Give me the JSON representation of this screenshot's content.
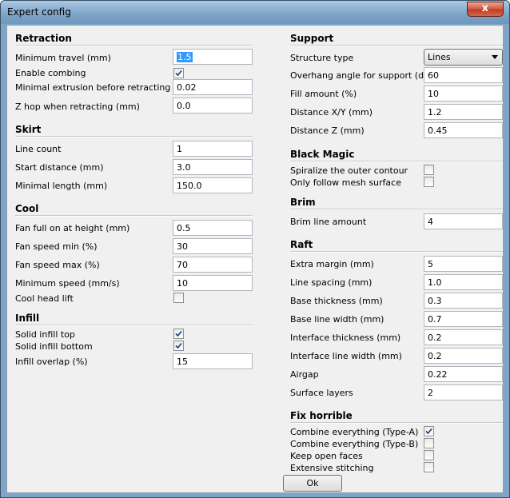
{
  "window": {
    "title": "Expert config",
    "close_glyph": "x"
  },
  "left": {
    "retraction": {
      "header": "Retraction",
      "min_travel": {
        "label": "Minimum travel (mm)",
        "value": "1.5"
      },
      "enable_combing": {
        "label": "Enable combing",
        "checked": true
      },
      "min_extrusion": {
        "label": "Minimal extrusion before retracting (mm)",
        "value": "0.02"
      },
      "z_hop": {
        "label": "Z hop when retracting (mm)",
        "value": "0.0"
      }
    },
    "skirt": {
      "header": "Skirt",
      "line_count": {
        "label": "Line count",
        "value": "1"
      },
      "start_distance": {
        "label": "Start distance (mm)",
        "value": "3.0"
      },
      "min_length": {
        "label": "Minimal length (mm)",
        "value": "150.0"
      }
    },
    "cool": {
      "header": "Cool",
      "fan_full_height": {
        "label": "Fan full on at height (mm)",
        "value": "0.5"
      },
      "fan_speed_min": {
        "label": "Fan speed min (%)",
        "value": "30"
      },
      "fan_speed_max": {
        "label": "Fan speed max (%)",
        "value": "70"
      },
      "min_speed": {
        "label": "Minimum speed (mm/s)",
        "value": "10"
      },
      "cool_head_lift": {
        "label": "Cool head lift",
        "checked": false
      }
    },
    "infill": {
      "header": "Infill",
      "solid_top": {
        "label": "Solid infill top",
        "checked": true
      },
      "solid_bottom": {
        "label": "Solid infill bottom",
        "checked": true
      },
      "overlap": {
        "label": "Infill overlap (%)",
        "value": "15"
      }
    }
  },
  "right": {
    "support": {
      "header": "Support",
      "structure_type": {
        "label": "Structure type",
        "value": "Lines"
      },
      "overhang_angle": {
        "label": "Overhang angle for support (deg)",
        "value": "60"
      },
      "fill_amount": {
        "label": "Fill amount (%)",
        "value": "10"
      },
      "distance_xy": {
        "label": "Distance X/Y (mm)",
        "value": "1.2"
      },
      "distance_z": {
        "label": "Distance Z (mm)",
        "value": "0.45"
      }
    },
    "black_magic": {
      "header": "Black Magic",
      "spiralize": {
        "label": "Spiralize the outer contour",
        "checked": false
      },
      "mesh_surface": {
        "label": "Only follow mesh surface",
        "checked": false
      }
    },
    "brim": {
      "header": "Brim",
      "line_amount": {
        "label": "Brim line amount",
        "value": "4"
      }
    },
    "raft": {
      "header": "Raft",
      "extra_margin": {
        "label": "Extra margin (mm)",
        "value": "5"
      },
      "line_spacing": {
        "label": "Line spacing (mm)",
        "value": "1.0"
      },
      "base_thickness": {
        "label": "Base thickness (mm)",
        "value": "0.3"
      },
      "base_line_width": {
        "label": "Base line width (mm)",
        "value": "0.7"
      },
      "interface_thickness": {
        "label": "Interface thickness (mm)",
        "value": "0.2"
      },
      "interface_line_width": {
        "label": "Interface line width (mm)",
        "value": "0.2"
      },
      "airgap": {
        "label": "Airgap",
        "value": "0.22"
      },
      "surface_layers": {
        "label": "Surface layers",
        "value": "2"
      }
    },
    "fix_horrible": {
      "header": "Fix horrible",
      "combine_a": {
        "label": "Combine everything (Type-A)",
        "checked": true
      },
      "combine_b": {
        "label": "Combine everything (Type-B)",
        "checked": false
      },
      "keep_open": {
        "label": "Keep open faces",
        "checked": false
      },
      "stitching": {
        "label": "Extensive stitching",
        "checked": false
      }
    }
  },
  "ok_label": "Ok"
}
